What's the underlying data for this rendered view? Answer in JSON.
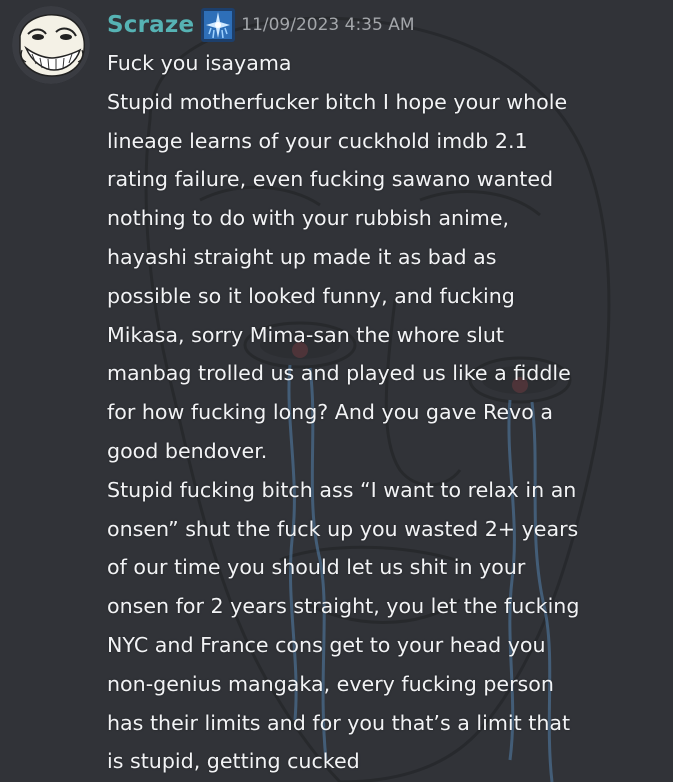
{
  "message": {
    "author": "Scraze",
    "timestamp": "11/09/2023 4:35 AM",
    "role_icon": "blue-sparkle-role-icon",
    "avatar_icon": "trollface-avatar-icon",
    "lines": [
      "Fuck you isayama",
      "Stupid motherfucker bitch I hope your whole",
      "lineage learns of your cuckhold imdb 2.1",
      "rating failure, even fucking sawano wanted",
      "nothing to do with your rubbish anime,",
      "hayashi straight up made it as bad as",
      "possible so it looked funny, and fucking",
      "Mikasa, sorry Mima-san the whore slut",
      "manbag trolled us and played us like a fiddle",
      "for how fucking long? And you gave Revo a",
      "good bendover.",
      "Stupid fucking bitch ass “I want to relax in an",
      "onsen” shut the fuck up you wasted 2+ years",
      "of our time you should let us shit in your",
      "onsen for 2 years straight, you let the fucking",
      "NYC and France cons get to your head you",
      "non-genius mangaka, every fucking person",
      "has their limits and for you that’s a limit that",
      "is stupid, getting cucked"
    ]
  },
  "colors": {
    "background": "#313338",
    "username": "#56b3b4",
    "timestamp": "#a3a6aa",
    "message_text": "#f2f3f5"
  }
}
